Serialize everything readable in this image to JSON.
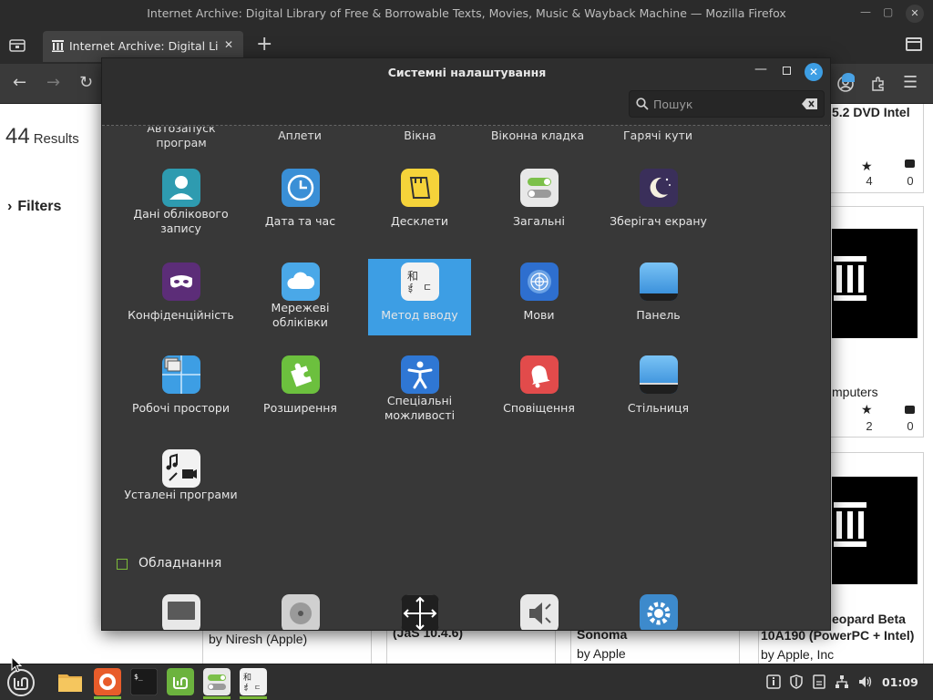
{
  "firefox": {
    "window_title": "Internet Archive: Digital Library of Free & Borrowable Texts, Movies, Music & Wayback Machine — Mozilla Firefox",
    "tab_title": "Internet Archive: Digital Lib",
    "new_tab": "+",
    "icons": [
      "tab-list-icon",
      "archive-favicon",
      "close-icon",
      "back-icon",
      "forward-icon",
      "reload-icon",
      "account-icon",
      "extensions-icon",
      "menu-icon"
    ]
  },
  "web": {
    "results_count": "44",
    "results_label": "Results",
    "filters_label": "Filters",
    "cards": [
      {
        "title": "5.2 DVD Intel",
        "favorites": "4",
        "reviews": "0"
      },
      {
        "title": "mputers",
        "favorites": "2",
        "reviews": "0"
      },
      {
        "title": "eopard Beta",
        "title2": "10A190 (PowerPC + Intel)",
        "creator": "by Apple, Inc"
      }
    ],
    "bottom_cards": [
      {
        "creator": "by Niresh (Apple)"
      },
      {
        "title": "(JaS 10.4.6)"
      },
      {
        "title": "Sonoma",
        "creator": "by Apple"
      }
    ]
  },
  "settings": {
    "title": "Системні налаштування",
    "search_placeholder": "Пошук",
    "cut_labels": [
      "Автозапуск програм",
      "Аплети",
      "Вікна",
      "Віконна кладка",
      "Гарячі кути"
    ],
    "items": [
      {
        "label": "Дані облікового запису",
        "icon": "account-details-icon",
        "color": "#2e9bb0"
      },
      {
        "label": "Дата та час",
        "icon": "clock-icon",
        "color": "#3a8fd6"
      },
      {
        "label": "Десклети",
        "icon": "desklets-icon",
        "color": "#f5d33a"
      },
      {
        "label": "Загальні",
        "icon": "general-toggle-icon",
        "color": "#e8e8e8"
      },
      {
        "label": "Зберігач екрану",
        "icon": "moon-icon",
        "color": "#3a2f5a"
      },
      {
        "label": "Конфіденційність",
        "icon": "privacy-mask-icon",
        "color": "#5c2d78"
      },
      {
        "label": "Мережеві обліківки",
        "icon": "cloud-icon",
        "color": "#4aa8e8"
      },
      {
        "label": "Метод вводу",
        "icon": "input-method-icon",
        "color": "#f2f2f2"
      },
      {
        "label": "Мови",
        "icon": "un-globe-icon",
        "color": "#2e6fcf"
      },
      {
        "label": "Панель",
        "icon": "panel-icon",
        "color": "#3d9ee4"
      },
      {
        "label": "Робочі простори",
        "icon": "workspaces-icon",
        "color": "#3d9ee4"
      },
      {
        "label": "Розширення",
        "icon": "puzzle-icon",
        "color": "#6cc03e"
      },
      {
        "label": "Спеціальні можливості",
        "icon": "accessibility-icon",
        "color": "#2f77d4"
      },
      {
        "label": "Сповіщення",
        "icon": "bell-icon",
        "color": "#e24b4b"
      },
      {
        "label": "Стільниця",
        "icon": "desktop-icon",
        "color": "#3d9ee4"
      },
      {
        "label": "Усталені програми",
        "icon": "default-apps-icon",
        "color": "#f2f2f2"
      }
    ],
    "hardware_section": "Обладнання",
    "hardware_icons": [
      "display-icon",
      "disks-icon",
      "screen-resize-icon",
      "sound-icon",
      "gear-icon"
    ]
  },
  "taskbar": {
    "clock": "01:09",
    "apps": [
      "menu-icon",
      "files-icon",
      "firefox-icon",
      "terminal-icon",
      "mint-update-icon",
      "settings-toggle-icon",
      "input-method-icon"
    ],
    "tray": [
      "info-icon",
      "shield-icon",
      "notes-icon",
      "network-icon",
      "volume-icon"
    ]
  }
}
